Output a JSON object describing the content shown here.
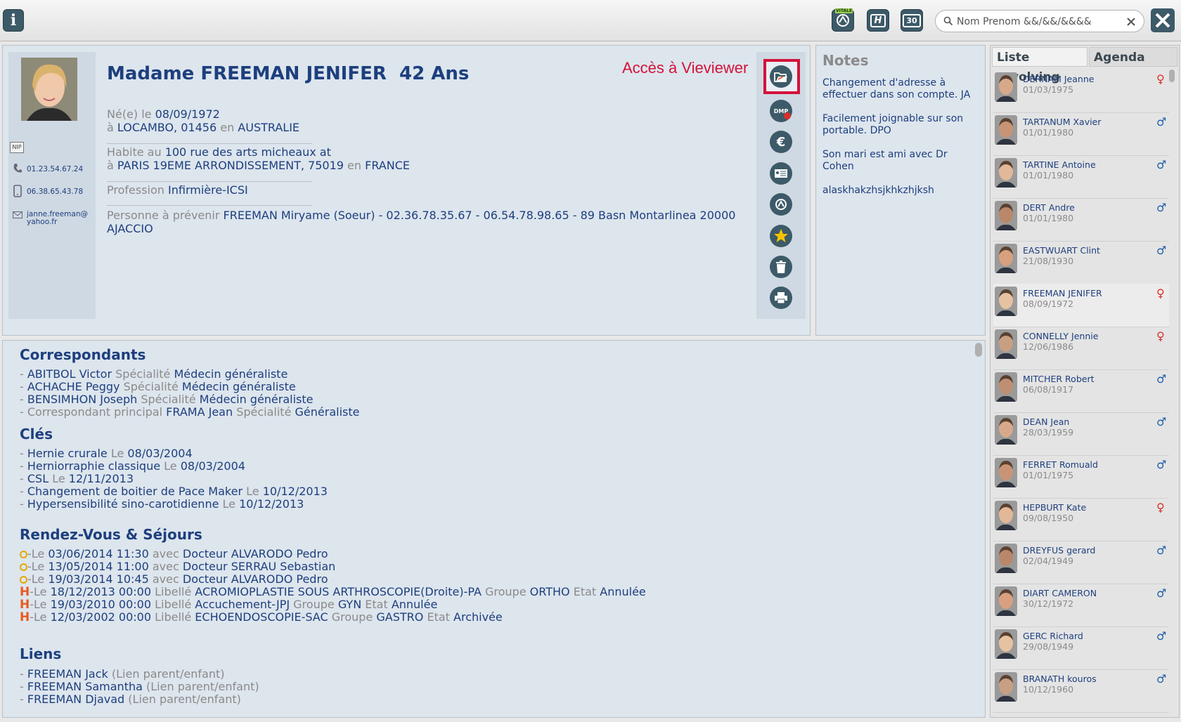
{
  "toolbar": {
    "info_label": "i",
    "vitale_label": "VITALE",
    "h_label": "H",
    "calendar_label": "30",
    "search_placeholder": "Nom Prenom &&/&&/&&&&"
  },
  "patient": {
    "name_line": "Madame FREEMAN JENIFER  42 Ans",
    "birth_prefix": "Né(e) le",
    "birth_date": "08/09/1972",
    "birth_place_prefix": "à",
    "birth_place": "LOCAMBO, 01456",
    "birth_country_prefix": "en",
    "birth_country": "AUSTRALIE",
    "address_prefix": "Habite au",
    "address_line1": "100 rue des arts micheaux at",
    "address_city_prefix": "à",
    "address_city": "PARIS 19EME ARRONDISSEMENT, 75019",
    "address_country_prefix": "en",
    "address_country": "FRANCE",
    "profession_prefix": "Profession",
    "profession": "Infirmière-ICSI",
    "contact_prefix": "Personne à prévenir",
    "contact": "FREEMAN Miryame (Soeur) - 02.36.78.35.67 - 06.54.78.98.65 - 89 Basn Montarlinea 20000 AJACCIO",
    "nip_label": "NIP",
    "phone": "01.23.54.67.24",
    "mobile": "06.38.65.43.78",
    "email": "janne.freeman@yahoo.fr"
  },
  "annotation": {
    "label": "Accès à Vieviewer",
    "color": "#d4123a"
  },
  "side_icons": {
    "dmp_label": "DMP",
    "euro_label": "€"
  },
  "notes": {
    "title": "Notes",
    "items": [
      "Changement d'adresse à effectuer dans son compte. JA",
      "Facilement joignable sur son portable. DPO",
      "Son mari est ami avec Dr Cohen",
      "alaskhakzhsjkhkzhjksh"
    ]
  },
  "correspondants": {
    "title": "Correspondants",
    "rows": [
      {
        "name": "ABITBOL Victor",
        "spec_label": "Spécialité",
        "spec": "Médecin généraliste"
      },
      {
        "name": "ACHACHE Peggy",
        "spec_label": "Spécialité",
        "spec": "Médecin généraliste"
      },
      {
        "name": "BENSIMHON Joseph",
        "spec_label": "Spécialité",
        "spec": "Médecin généraliste"
      }
    ],
    "principal_label": "Correspondant principal",
    "principal_name": "FRAMA Jean",
    "principal_spec_label": "Spécialité",
    "principal_spec": "Généraliste"
  },
  "cles": {
    "title": "Clés",
    "rows": [
      {
        "label": "Hernie crurale",
        "le": "Le",
        "date": "08/03/2004"
      },
      {
        "label": "Herniorraphie classique",
        "le": "Le",
        "date": "08/03/2004"
      },
      {
        "label": "CSL",
        "le": "Le",
        "date": "12/11/2013"
      },
      {
        "label": "Changement de boitier de Pace Maker",
        "le": "Le",
        "date": "10/12/2013"
      },
      {
        "label": "Hypersensibilité sino-carotidienne",
        "le": "Le",
        "date": "10/12/2013"
      }
    ]
  },
  "rdv": {
    "title": "Rendez-Vous & Séjours",
    "appointments": [
      {
        "datetime": "03/06/2014 11:30",
        "avec": "avec",
        "doctor": "Docteur ALVARODO Pedro"
      },
      {
        "datetime": "13/05/2014 11:00",
        "avec": "avec",
        "doctor": "Docteur SERRAU Sebastian"
      },
      {
        "datetime": "19/03/2014 10:45",
        "avec": "avec",
        "doctor": "Docteur ALVARODO Pedro"
      }
    ],
    "stays": [
      {
        "datetime": "18/12/2013 00:00",
        "libelle": "ACROMIOPLASTIE SOUS ARTHROSCOPIE(Droite)-PA",
        "groupe": "ORTHO",
        "etat": "Annulée"
      },
      {
        "datetime": "19/03/2010 00:00",
        "libelle": "Accuchement-JPJ",
        "groupe": "GYN",
        "etat": "Annulée"
      },
      {
        "datetime": "12/03/2002 00:00",
        "libelle": "ECHOENDOSCOPIE-SAC",
        "groupe": "GASTRO",
        "etat": "Archivée"
      }
    ],
    "le_prefix": "-Le",
    "libelle_label": "Libellé",
    "groupe_label": "Groupe",
    "etat_label": "Etat",
    "h_glyph": "H"
  },
  "liens": {
    "title": "Liens",
    "rows": [
      {
        "name": "FREEMAN Jack",
        "rel": "(Lien parent/enfant)"
      },
      {
        "name": "FREEMAN Samantha",
        "rel": "(Lien parent/enfant)"
      },
      {
        "name": "FREEMAN Djavad",
        "rel": "(Lien parent/enfant)"
      }
    ]
  },
  "right_panel": {
    "tabs": [
      "Liste revolving",
      "Agenda"
    ],
    "patients": [
      {
        "name": "DERNAM  Jeanne",
        "dob": "01/03/1975",
        "sex": "♀"
      },
      {
        "name": "TARTANUM  Xavier",
        "dob": "01/01/1980",
        "sex": "♂"
      },
      {
        "name": "TARTINE  Antoine",
        "dob": "01/01/1980",
        "sex": "♂"
      },
      {
        "name": "DERT  Andre",
        "dob": "01/01/1980",
        "sex": "♂"
      },
      {
        "name": "EASTWUART  Clint",
        "dob": "21/08/1930",
        "sex": "♂"
      },
      {
        "name": "FREEMAN  JENIFER",
        "dob": "08/09/1972",
        "sex": "♀"
      },
      {
        "name": "CONNELLY  Jennie",
        "dob": "12/06/1986",
        "sex": "♀"
      },
      {
        "name": "MITCHER  Robert",
        "dob": "06/08/1917",
        "sex": "♂"
      },
      {
        "name": "DEAN  Jean",
        "dob": "28/03/1959",
        "sex": "♂"
      },
      {
        "name": "FERRET  Romuald",
        "dob": "01/01/1975",
        "sex": "♂"
      },
      {
        "name": "HEPBURT  Kate",
        "dob": "09/08/1950",
        "sex": "♀"
      },
      {
        "name": "DREYFUS  gerard",
        "dob": "02/04/1949",
        "sex": "♂"
      },
      {
        "name": "DIART  CAMERON",
        "dob": "30/12/1972",
        "sex": "♂"
      },
      {
        "name": "GERC  Richard",
        "dob": "29/08/1949",
        "sex": "♂"
      },
      {
        "name": "BRANATH  kouros",
        "dob": "10/12/1960",
        "sex": "♂"
      }
    ]
  },
  "colors": {
    "accent_blue": "#1d3f7e",
    "label_grey": "#8a8a8a",
    "female": "#d9302a",
    "male": "#1d5fa8",
    "stay_orange": "#e85a1e",
    "clock_yellow": "#e6a800"
  }
}
